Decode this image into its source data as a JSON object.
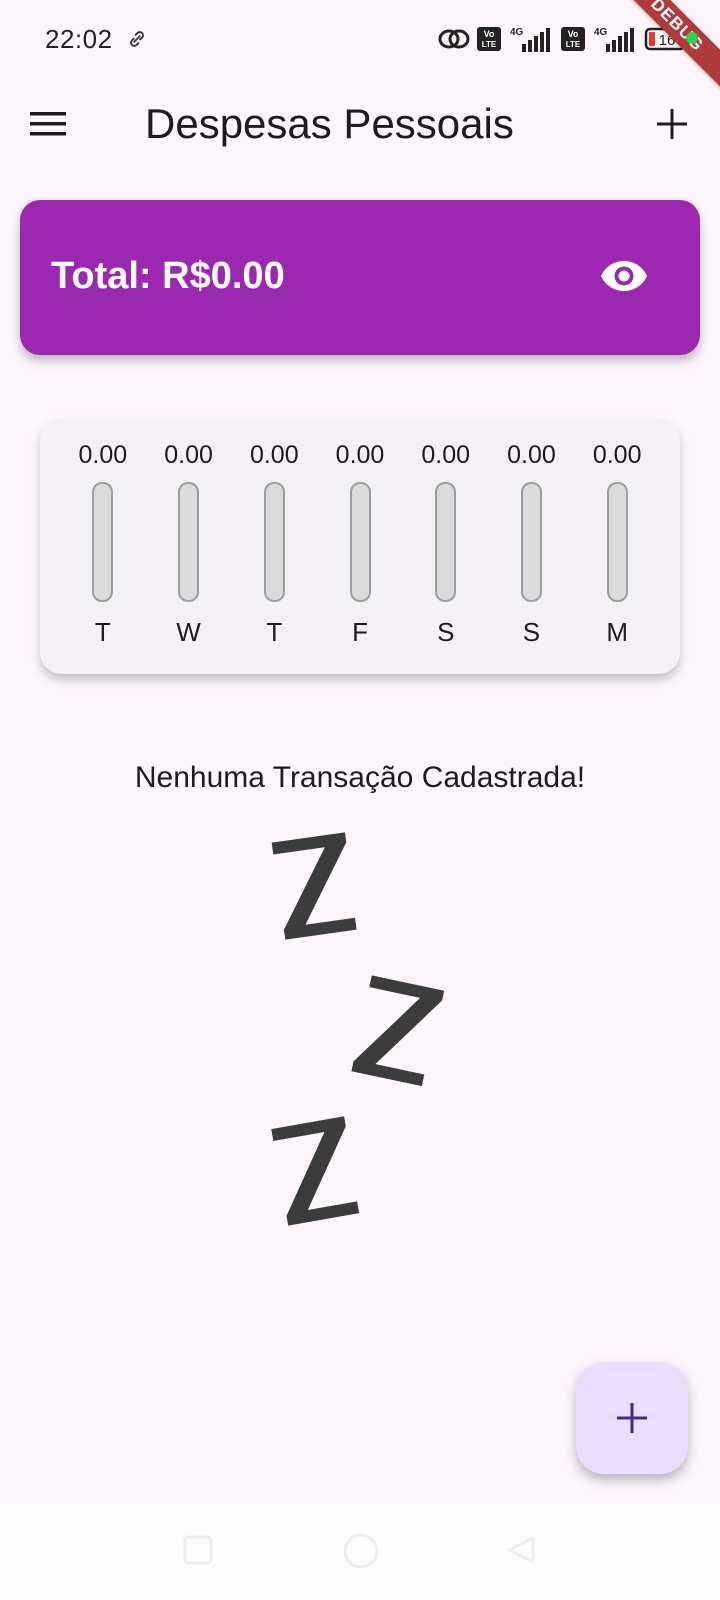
{
  "status_bar": {
    "time": "22:02",
    "battery": "16"
  },
  "debug_banner": "DEBUG",
  "app_bar": {
    "title": "Despesas Pessoais"
  },
  "total_card": {
    "label": "Total: R$0.00",
    "color": "#9c27b0"
  },
  "chart": {
    "card_bg": "#f4f1f6"
  },
  "chart_data": {
    "type": "bar",
    "categories": [
      "T",
      "W",
      "T",
      "F",
      "S",
      "S",
      "M"
    ],
    "values": [
      0,
      0,
      0,
      0,
      0,
      0,
      0
    ],
    "value_labels": [
      "0.00",
      "0.00",
      "0.00",
      "0.00",
      "0.00",
      "0.00",
      "0.00"
    ],
    "title": "",
    "xlabel": "",
    "ylabel": "",
    "grid": false,
    "legend": "none"
  },
  "empty_state": {
    "message": "Nenhuma Transação Cadastrada!",
    "image_icon": "sleeping-zzz-icon"
  },
  "fab": {
    "icon": "plus-icon",
    "color": "#eaddff"
  },
  "icons": {
    "menu": "menu-icon",
    "add": "plus-icon",
    "visibility": "eye-icon"
  }
}
